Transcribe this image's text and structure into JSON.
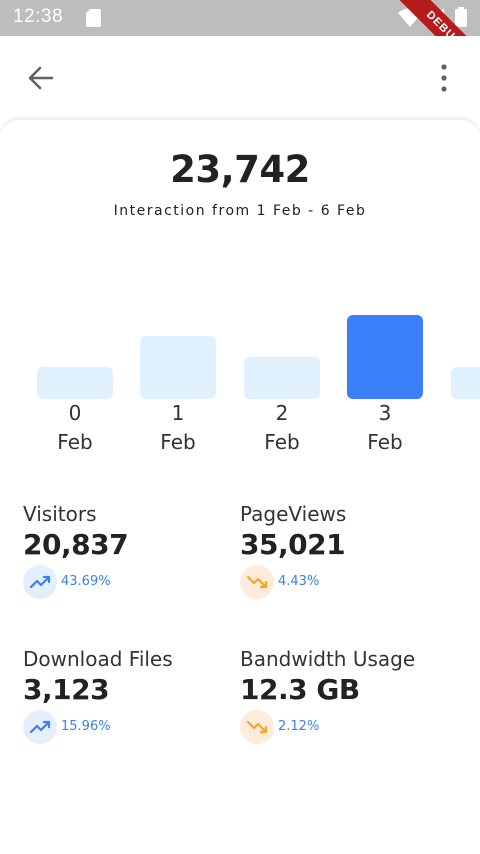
{
  "status_bar": {
    "time": "12:38",
    "debug_label": "DEBUG"
  },
  "header": {
    "total": "23,742",
    "range": "Interaction from 1 Feb - 6 Feb"
  },
  "chart_data": {
    "type": "bar",
    "categories": [
      "0\nFeb",
      "1\nFeb",
      "2\nFeb",
      "3\nFeb"
    ],
    "values": [
      32,
      63,
      42,
      84
    ],
    "highlighted_index": 3,
    "title": "",
    "xlabel": "",
    "ylabel": "",
    "colors": {
      "default": "#e1f0fd",
      "highlight": "#3a7ef8"
    }
  },
  "chart_labels": [
    {
      "num": "0",
      "month": "Feb"
    },
    {
      "num": "1",
      "month": "Feb"
    },
    {
      "num": "2",
      "month": "Feb"
    },
    {
      "num": "3",
      "month": "Feb"
    }
  ],
  "stats": [
    {
      "label": "Visitors",
      "value": "20,837",
      "change": "43.69%",
      "trend": "up",
      "icon": "trending-up-icon"
    },
    {
      "label": "PageViews",
      "value": "35,021",
      "change": "4.43%",
      "trend": "down",
      "icon": "trending-down-icon"
    },
    {
      "label": "Download Files",
      "value": "3,123",
      "change": "15.96%",
      "trend": "up",
      "icon": "trending-up-icon"
    },
    {
      "label": "Bandwidth Usage",
      "value": "12.3 GB",
      "change": "2.12%",
      "trend": "down",
      "icon": "trending-down-icon"
    }
  ],
  "colors": {
    "up": "#3b7ff0",
    "down": "#f5a623",
    "text": "#222222"
  }
}
